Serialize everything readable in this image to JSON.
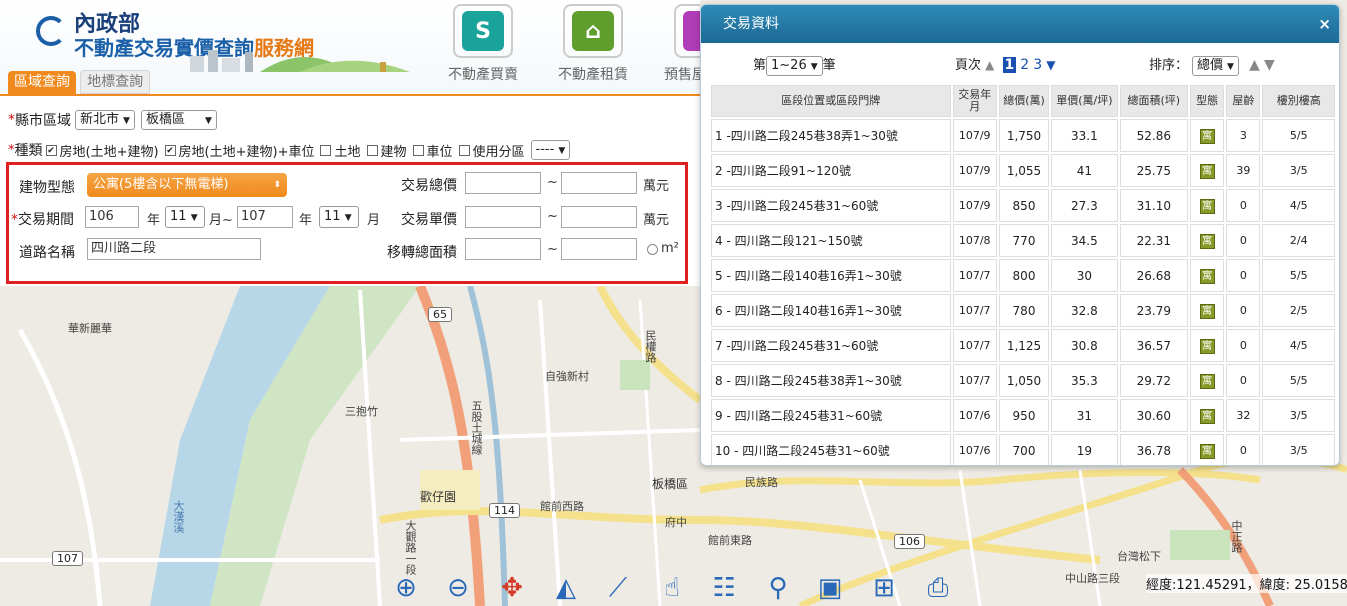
{
  "header": {
    "dept": "內政部",
    "title_main": "不動產交易實價查詢",
    "title_accent": "服務網",
    "nav": [
      {
        "label": "不動產買賣",
        "glyph": "S",
        "color": "#1aa39a"
      },
      {
        "label": "不動產租賃",
        "glyph": "⌂",
        "color": "#5f9e2c"
      },
      {
        "label": "預售屋",
        "glyph": "║",
        "color": "#b03cb8"
      }
    ],
    "tabs": [
      "區域查詢",
      "地標查詢"
    ]
  },
  "form": {
    "city_label": "縣市區域",
    "city_value": "新北市",
    "district_value": "板橋區",
    "type_label": "種類",
    "types": [
      {
        "label": "房地(土地+建物)",
        "checked": true
      },
      {
        "label": "房地(土地+建物)+車位",
        "checked": true
      },
      {
        "label": "土地",
        "checked": false
      },
      {
        "label": "建物",
        "checked": false
      },
      {
        "label": "車位",
        "checked": false
      },
      {
        "label": "使用分區",
        "checked": false
      }
    ],
    "zone_value": "----",
    "building_type_label": "建物型態",
    "building_type_value": "公寓(5樓含以下無電梯)",
    "period_label": "交易期間",
    "year_from": "106",
    "year_unit": "年",
    "month_from": "11",
    "month_unit": "月~",
    "year_to": "107",
    "year_unit2": "年",
    "month_to": "11",
    "month_unit2": "月",
    "road_label": "道路名稱",
    "road_value": "四川路二段",
    "total_price_label": "交易總價",
    "unit_price_label": "交易單價",
    "area_label": "移轉總面積",
    "tilde": "~",
    "wan_unit": "萬元",
    "wan_unit2": "萬元",
    "m2_unit": "m²"
  },
  "panel": {
    "title": "交易資料",
    "close": "×",
    "range_prefix": "第",
    "range_value": "1~26",
    "range_suffix": "筆",
    "page_label": "頁次",
    "pages": [
      "1",
      "2",
      "3"
    ],
    "sort_label": "排序：",
    "sort_value": "總價",
    "columns": [
      "區段位置或區段門牌",
      "交易年月",
      "總價(萬)",
      "單價(萬/坪)",
      "總面積(坪)",
      "型態",
      "屋齡",
      "樓別樓高"
    ],
    "type_glyph": "寓",
    "rows": [
      {
        "addr": "1 -四川路二段245巷38弄1~30號",
        "ym": "107/9",
        "total": "1,750",
        "unit": "33.1",
        "area": "52.86",
        "age": "3",
        "floor": "5/5"
      },
      {
        "addr": "2 -四川路二段91~120號",
        "ym": "107/9",
        "total": "1,055",
        "unit": "41",
        "area": "25.75",
        "age": "39",
        "floor": "3/5"
      },
      {
        "addr": "3 -四川路二段245巷31~60號",
        "ym": "107/9",
        "total": "850",
        "unit": "27.3",
        "area": "31.10",
        "age": "0",
        "floor": "4/5"
      },
      {
        "addr": "4 - 四川路二段121~150號",
        "ym": "107/8",
        "total": "770",
        "unit": "34.5",
        "area": "22.31",
        "age": "0",
        "floor": "2/4"
      },
      {
        "addr": "5 - 四川路二段140巷16弄1~30號",
        "ym": "107/7",
        "total": "800",
        "unit": "30",
        "area": "26.68",
        "age": "0",
        "floor": "5/5"
      },
      {
        "addr": "6 - 四川路二段140巷16弄1~30號",
        "ym": "107/7",
        "total": "780",
        "unit": "32.8",
        "area": "23.79",
        "age": "0",
        "floor": "2/5"
      },
      {
        "addr": "7 -四川路二段245巷31~60號",
        "ym": "107/7",
        "total": "1,125",
        "unit": "30.8",
        "area": "36.57",
        "age": "0",
        "floor": "4/5"
      },
      {
        "addr": "8 - 四川路二段245巷38弄1~30號",
        "ym": "107/7",
        "total": "1,050",
        "unit": "35.3",
        "area": "29.72",
        "age": "0",
        "floor": "5/5"
      },
      {
        "addr": "9 - 四川路二段245巷31~60號",
        "ym": "107/6",
        "total": "950",
        "unit": "31",
        "area": "30.60",
        "age": "32",
        "floor": "3/5"
      },
      {
        "addr": "10 - 四川路二段245巷31~60號",
        "ym": "107/6",
        "total": "700",
        "unit": "19",
        "area": "36.78",
        "age": "0",
        "floor": "3/5"
      }
    ]
  },
  "map": {
    "labels": [
      "華新麗華",
      "自強新村",
      "三抱竹",
      "歡仔園",
      "板橋區",
      "台灣松下",
      "大漢溪",
      "府中",
      "民族路",
      "中山路三段",
      "館前西路",
      "館前東路",
      "民權路",
      "五股土城線",
      "中正路",
      "大觀路一段"
    ],
    "shields": [
      "65",
      "114",
      "107",
      "106"
    ]
  },
  "toolbar": {
    "tools": [
      "zoom-in-icon",
      "zoom-out-icon",
      "pan-icon",
      "measure-area-icon",
      "measure-line-icon",
      "locate-icon",
      "layers-icon",
      "route-icon",
      "frame-icon",
      "frame-alt-icon",
      "print-icon"
    ]
  },
  "coords": "經度:121.45291，緯度: 25.01585"
}
